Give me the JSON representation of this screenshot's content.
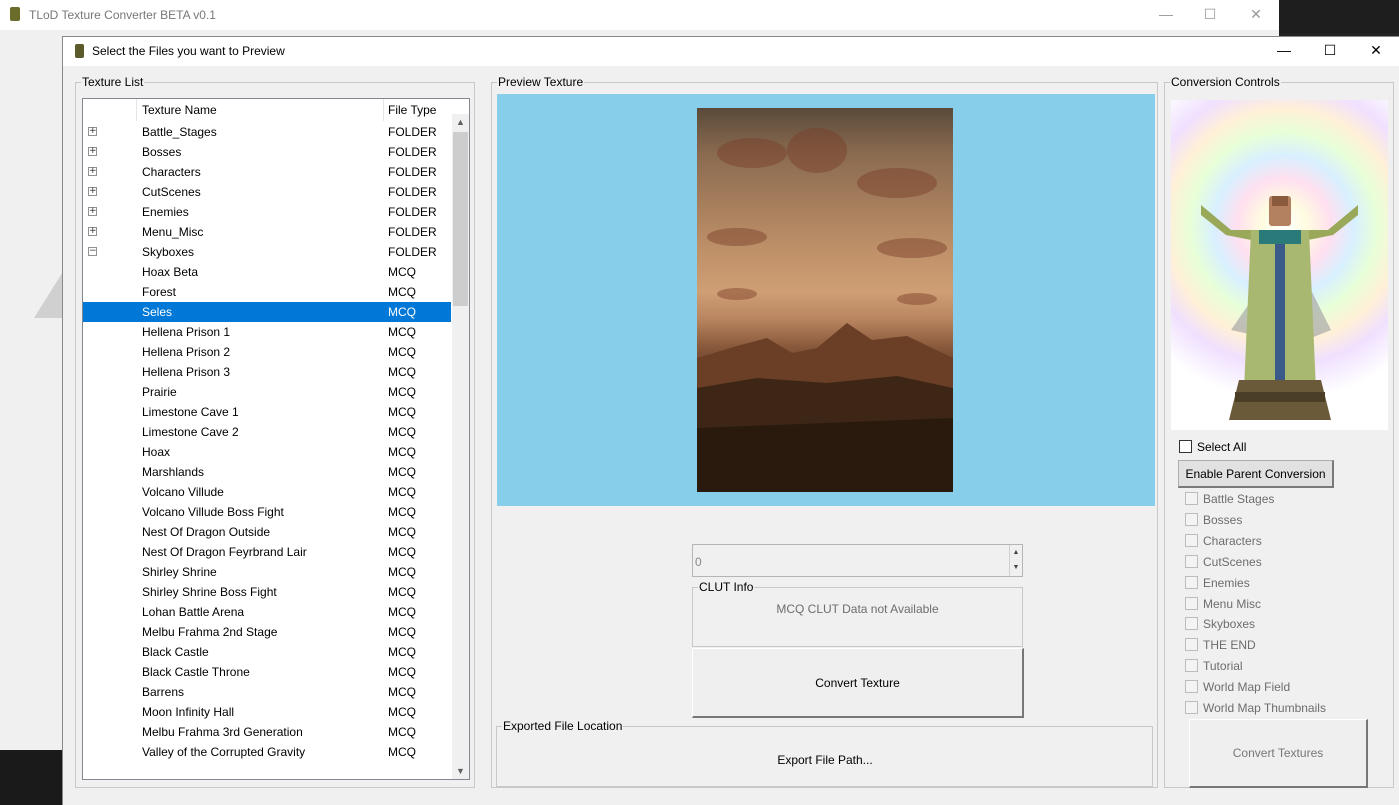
{
  "background_window": {
    "title": "TLoD Texture Converter BETA v0.1"
  },
  "dialog": {
    "title": "Select the Files you want to Preview",
    "minimize": "—",
    "maximize": "☐",
    "close": "✕"
  },
  "texture_list": {
    "legend": "Texture List",
    "columns": {
      "name": "Texture Name",
      "type": "File Type"
    },
    "rows": [
      {
        "expander": "+",
        "name": "Battle_Stages",
        "type": "FOLDER"
      },
      {
        "expander": "+",
        "name": "Bosses",
        "type": "FOLDER"
      },
      {
        "expander": "+",
        "name": "Characters",
        "type": "FOLDER"
      },
      {
        "expander": "+",
        "name": "CutScenes",
        "type": "FOLDER"
      },
      {
        "expander": "+",
        "name": "Enemies",
        "type": "FOLDER"
      },
      {
        "expander": "+",
        "name": "Menu_Misc",
        "type": "FOLDER"
      },
      {
        "expander": "−",
        "name": "Skyboxes",
        "type": "FOLDER"
      },
      {
        "name": "Hoax Beta",
        "type": "MCQ"
      },
      {
        "name": "Forest",
        "type": "MCQ"
      },
      {
        "name": "Seles",
        "type": "MCQ",
        "selected": true
      },
      {
        "name": "Hellena Prison 1",
        "type": "MCQ"
      },
      {
        "name": "Hellena Prison 2",
        "type": "MCQ"
      },
      {
        "name": "Hellena Prison 3",
        "type": "MCQ"
      },
      {
        "name": "Prairie",
        "type": "MCQ"
      },
      {
        "name": "Limestone Cave 1",
        "type": "MCQ"
      },
      {
        "name": "Limestone Cave 2",
        "type": "MCQ"
      },
      {
        "name": "Hoax",
        "type": "MCQ"
      },
      {
        "name": "Marshlands",
        "type": "MCQ"
      },
      {
        "name": "Volcano Villude",
        "type": "MCQ"
      },
      {
        "name": "Volcano Villude Boss Fight",
        "type": "MCQ"
      },
      {
        "name": "Nest Of Dragon Outside",
        "type": "MCQ"
      },
      {
        "name": "Nest Of Dragon Feyrbrand Lair",
        "type": "MCQ"
      },
      {
        "name": "Shirley Shrine",
        "type": "MCQ"
      },
      {
        "name": "Shirley Shrine Boss Fight",
        "type": "MCQ"
      },
      {
        "name": "Lohan Battle Arena",
        "type": "MCQ"
      },
      {
        "name": "Melbu Frahma 2nd Stage",
        "type": "MCQ"
      },
      {
        "name": "Black Castle",
        "type": "MCQ"
      },
      {
        "name": "Black Castle Throne",
        "type": "MCQ"
      },
      {
        "name": "Barrens",
        "type": "MCQ"
      },
      {
        "name": "Moon Infinity Hall",
        "type": "MCQ"
      },
      {
        "name": "Melbu Frahma 3rd Generation",
        "type": "MCQ"
      },
      {
        "name": "Valley of the Corrupted Gravity",
        "type": "MCQ"
      }
    ]
  },
  "preview": {
    "legend": "Preview Texture",
    "background_color": "#87ceeb",
    "clut_index_value": "0",
    "clut_info_legend": "CLUT Info",
    "clut_info_text": "MCQ CLUT Data not Available",
    "convert_button": "Convert Texture",
    "export_legend": "Exported File Location",
    "export_text": "Export File Path..."
  },
  "conversion": {
    "legend": "Conversion Controls",
    "select_all": "Select All",
    "enable_parent": "Enable Parent Conversion",
    "categories": [
      "Battle Stages",
      "Bosses",
      "Characters",
      "CutScenes",
      "Enemies",
      "Menu Misc",
      "Skyboxes",
      "THE END",
      "Tutorial",
      "World Map Field",
      "World Map Thumbnails"
    ],
    "convert_all": "Convert Textures"
  },
  "colors": {
    "selection": "#0078d7",
    "dialog_bg": "#f0f0f0"
  }
}
